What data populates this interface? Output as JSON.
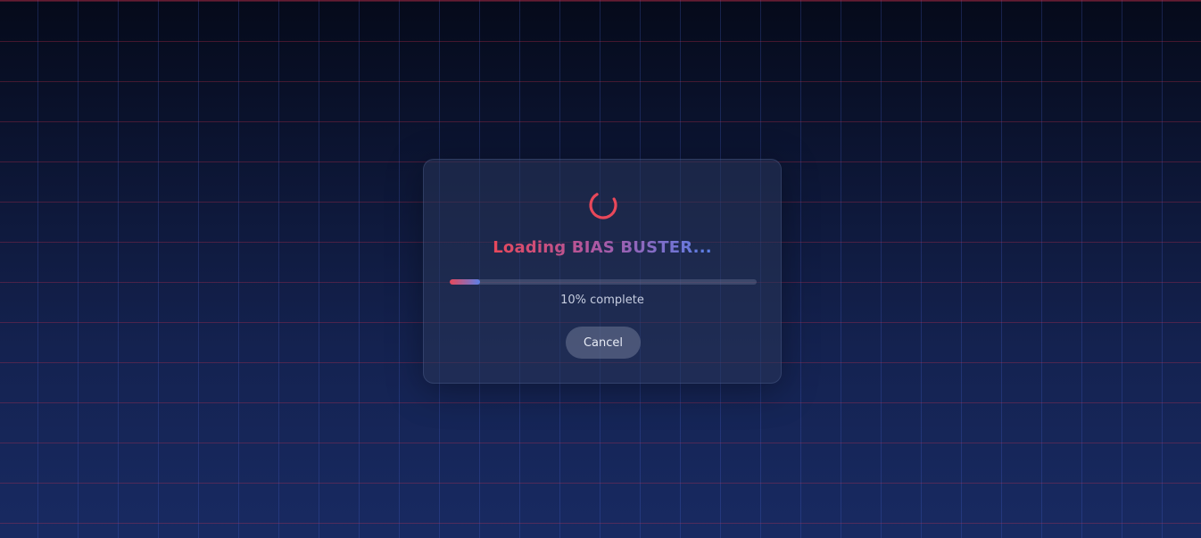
{
  "loader": {
    "icon": "spinner-icon",
    "title": "Loading BIAS BUSTER...",
    "progress_percent": 10,
    "progress_text": "10% complete",
    "cancel_label": "Cancel"
  },
  "colors": {
    "spinner": "#e8485a",
    "gradient_start": "#e8485a",
    "gradient_end": "#5a80e8",
    "grid_horizontal": "#e13250",
    "grid_vertical": "#465fc8",
    "background_top": "#050a1a",
    "background_bottom": "#182a62"
  }
}
